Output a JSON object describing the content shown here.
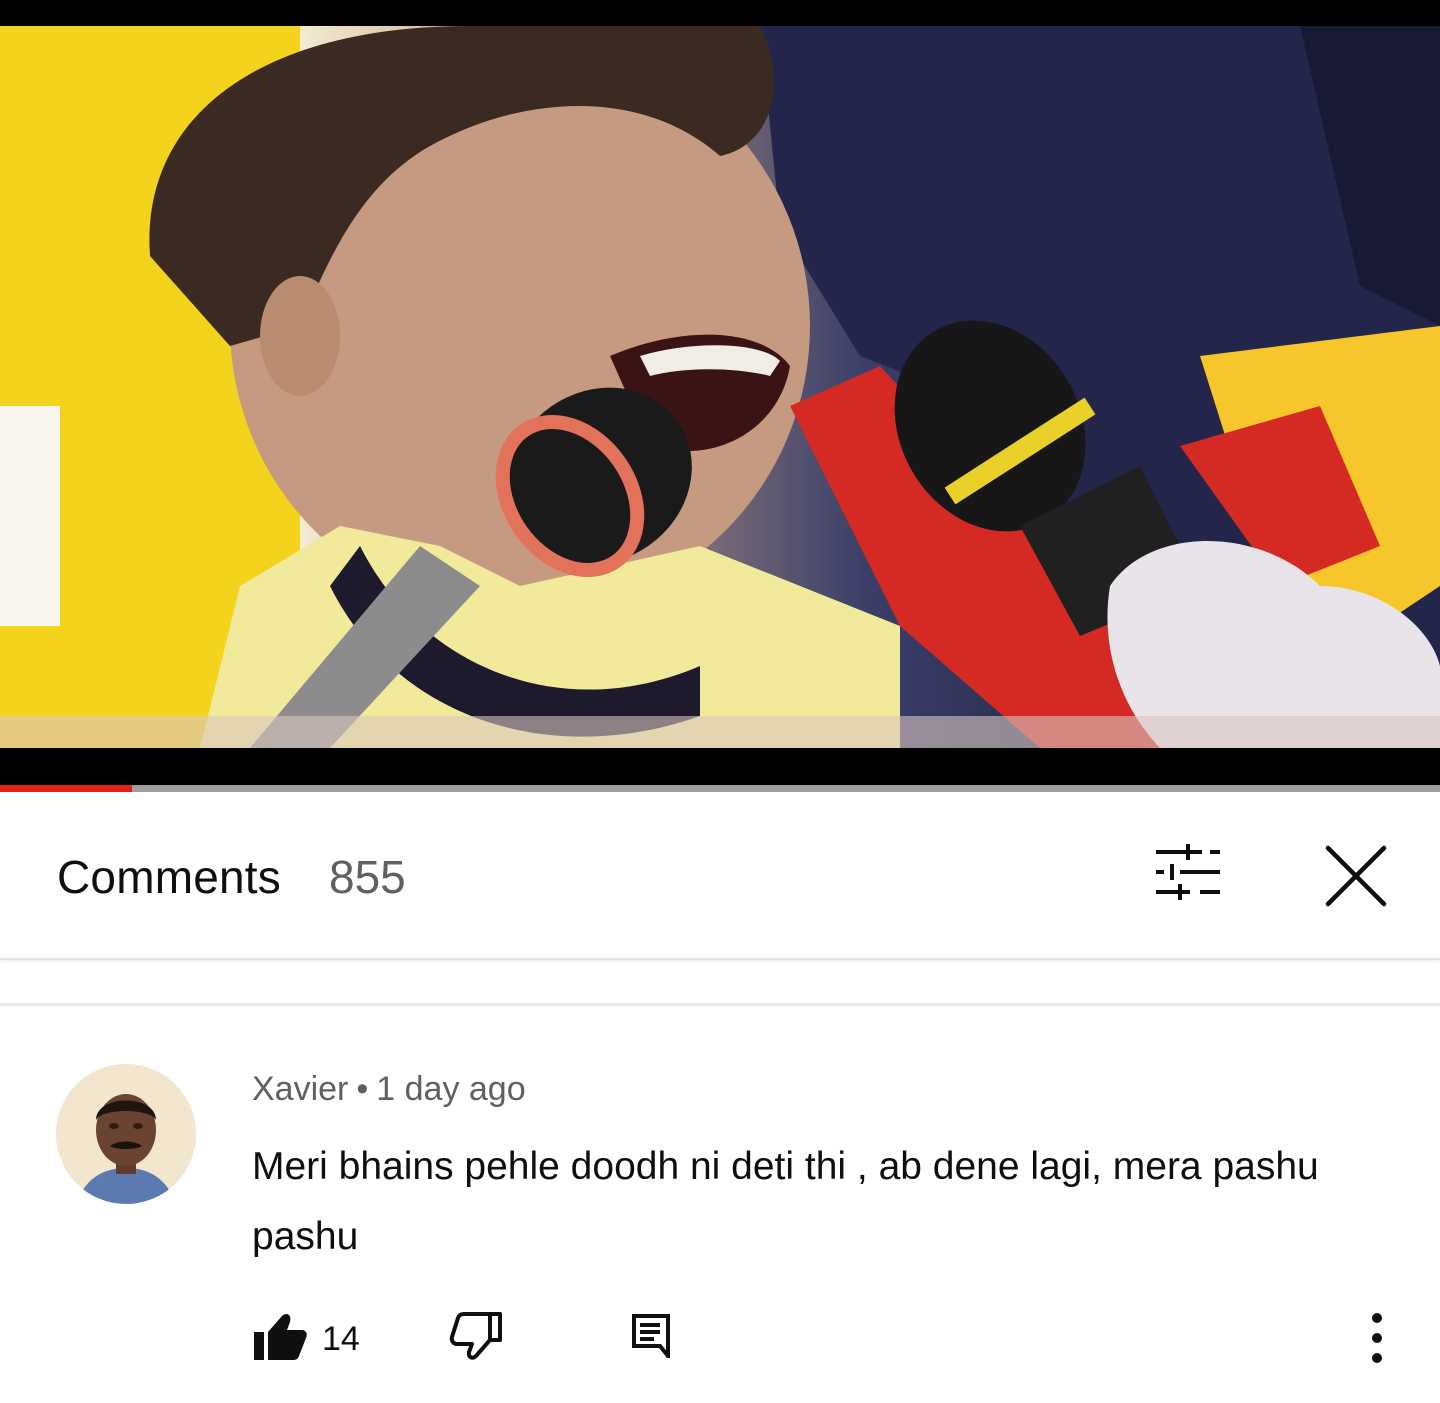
{
  "player": {
    "progress_fraction": 0.092,
    "progress_color": "#e62117"
  },
  "comments_panel": {
    "title": "Comments",
    "count": "855",
    "filter_icon": "sort-filter-icon",
    "close_icon": "close-icon"
  },
  "comment": {
    "author": "Xavier",
    "separator": "•",
    "time": "1 day ago",
    "text": "Meri bhains pehle doodh ni deti thi , ab dene lagi, mera pashu pashu",
    "likes": "14",
    "icons": {
      "like": "thumbs-up-icon",
      "dislike": "thumbs-down-icon",
      "reply": "reply-icon",
      "more": "more-vert-icon"
    }
  }
}
